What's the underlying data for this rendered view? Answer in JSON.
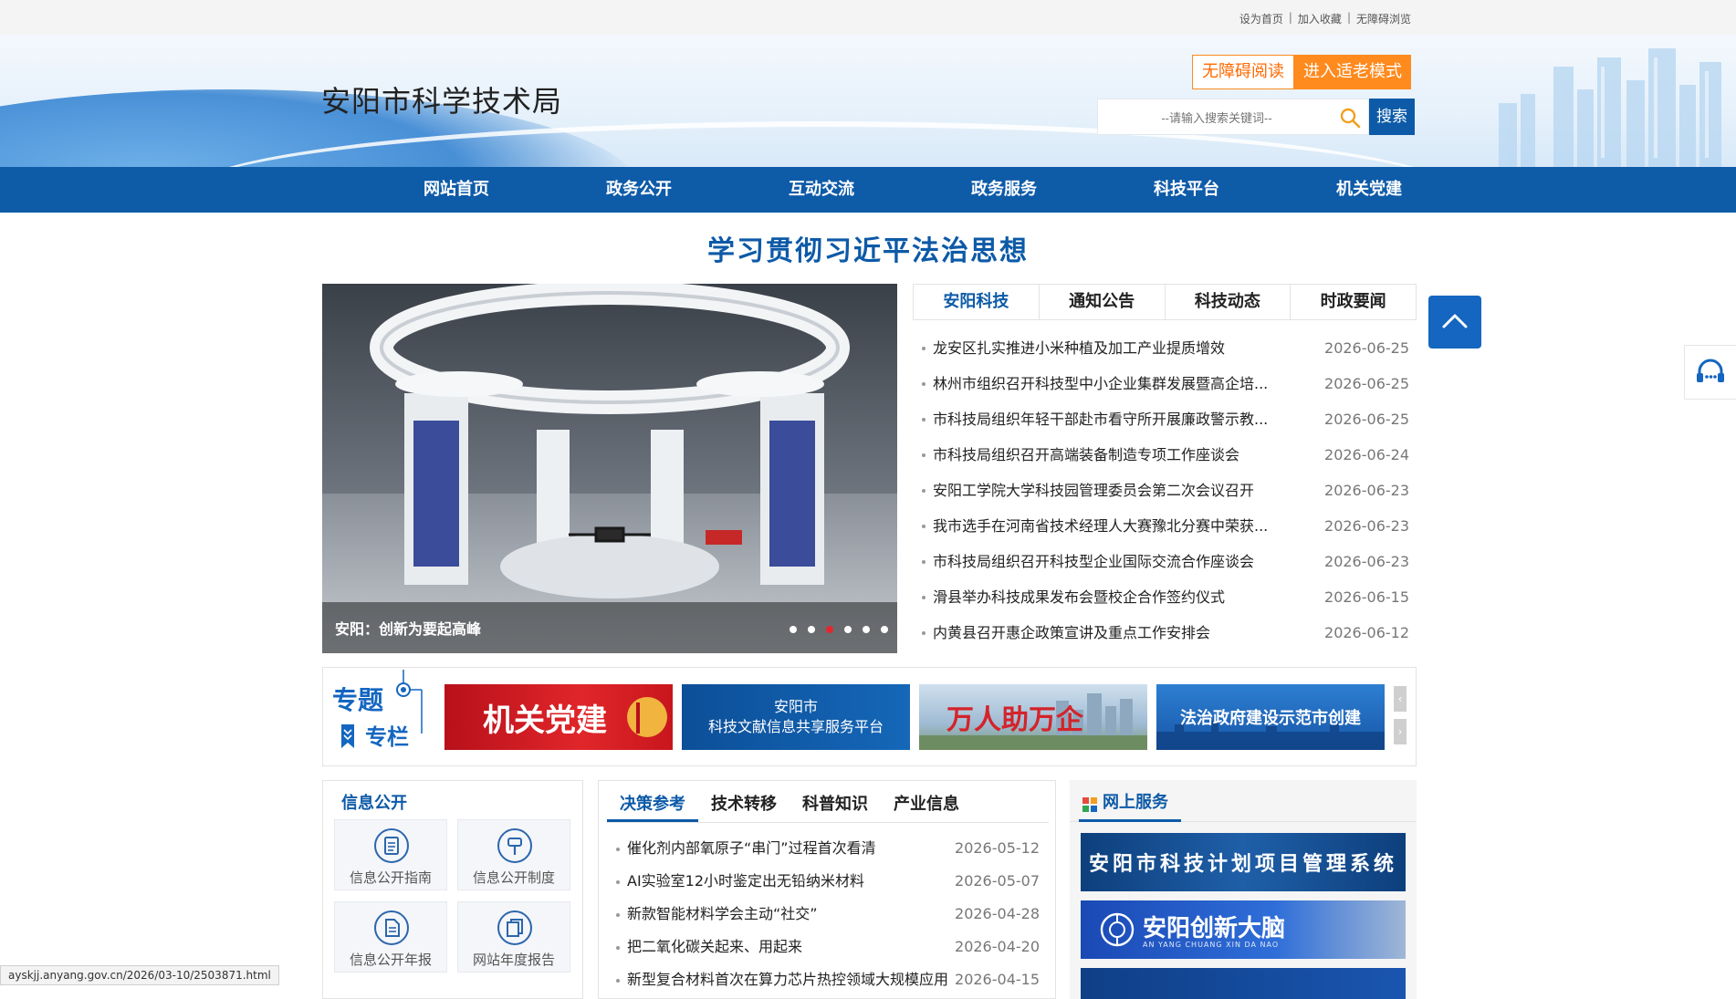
{
  "topbar": {
    "links": [
      "设为首页",
      "加入收藏",
      "无障碍浏览"
    ]
  },
  "header": {
    "site_title": "安阳市科学技术局",
    "accessibility_button": "无障碍阅读",
    "elder_mode_button": "进入适老模式",
    "search_placeholder": "--请输入搜索关键词--",
    "search_button": "搜索"
  },
  "nav": {
    "items": [
      "网站首页",
      "政务公开",
      "互动交流",
      "政务服务",
      "科技平台",
      "机关党建"
    ]
  },
  "banner": {
    "title": "学习贯彻习近平法治思想"
  },
  "slideshow": {
    "caption": "安阳：创新为要起高峰",
    "dot_count": 6,
    "active_dot": 3
  },
  "news": {
    "tabs": [
      "安阳科技",
      "通知公告",
      "科技动态",
      "时政要闻"
    ],
    "active_tab": 0,
    "items": [
      {
        "title": "龙安区扎实推进小米种植及加工产业提质增效",
        "date": "2026-06-25"
      },
      {
        "title": "林州市组织召开科技型中小企业集群发展暨高企培...",
        "date": "2026-06-25"
      },
      {
        "title": "市科技局组织年轻干部赴市看守所开展廉政警示教...",
        "date": "2026-06-25"
      },
      {
        "title": "市科技局组织召开高端装备制造专项工作座谈会",
        "date": "2026-06-24"
      },
      {
        "title": "安阳工学院大学科技园管理委员会第二次会议召开",
        "date": "2026-06-23"
      },
      {
        "title": "我市选手在河南省技术经理人大赛豫北分赛中荣获...",
        "date": "2026-06-23"
      },
      {
        "title": "市科技局组织召开科技型企业国际交流合作座谈会",
        "date": "2026-06-23"
      },
      {
        "title": "滑县举办科技成果发布会暨校企合作签约仪式",
        "date": "2026-06-15"
      },
      {
        "title": "内黄县召开惠企政策宣讲及重点工作安排会",
        "date": "2026-06-12"
      }
    ]
  },
  "topics": {
    "logo_line1": "专题",
    "logo_line2": "专栏",
    "items": [
      {
        "label": "机关党建",
        "color": "#c8161d"
      },
      {
        "label": "安阳市\n科技文献信息共享服务平台",
        "color": "#0f5aa8"
      },
      {
        "label": "万人助万企",
        "color": "#d22a2a"
      },
      {
        "label": "法治政府建设示范市创建",
        "color": "#1f66b4"
      }
    ]
  },
  "info": {
    "title": "信息公开",
    "tiles": [
      "信息公开指南",
      "信息公开制度",
      "信息公开年报",
      "网站年度报告"
    ]
  },
  "middle": {
    "tabs": [
      "决策参考",
      "技术转移",
      "科普知识",
      "产业信息"
    ],
    "active_tab": 0,
    "items": [
      {
        "title": "催化剂内部氧原子“串门”过程首次看清",
        "date": "2026-05-12"
      },
      {
        "title": "AI实验室12小时鉴定出无铅纳米材料",
        "date": "2026-05-07"
      },
      {
        "title": "新款智能材料学会主动“社交”",
        "date": "2026-04-28"
      },
      {
        "title": "把二氧化碳关起来、用起来",
        "date": "2026-04-20"
      },
      {
        "title": "新型复合材料首次在算力芯片热控领域大规模应用",
        "date": "2026-04-15"
      }
    ]
  },
  "service": {
    "title": "网上服务",
    "banners": [
      "安阳市科技计划项目管理系统",
      "安阳创新大脑"
    ],
    "banner2_sub": "AN YANG CHUANG XIN DA NAO"
  },
  "statusbar": {
    "url": "ayskjj.anyang.gov.cn/2026/03-10/2503871.html"
  },
  "colors": {
    "primary": "#0e5ba8",
    "accent_orange": "#ff8a1e",
    "active_dot": "#e3272d"
  }
}
